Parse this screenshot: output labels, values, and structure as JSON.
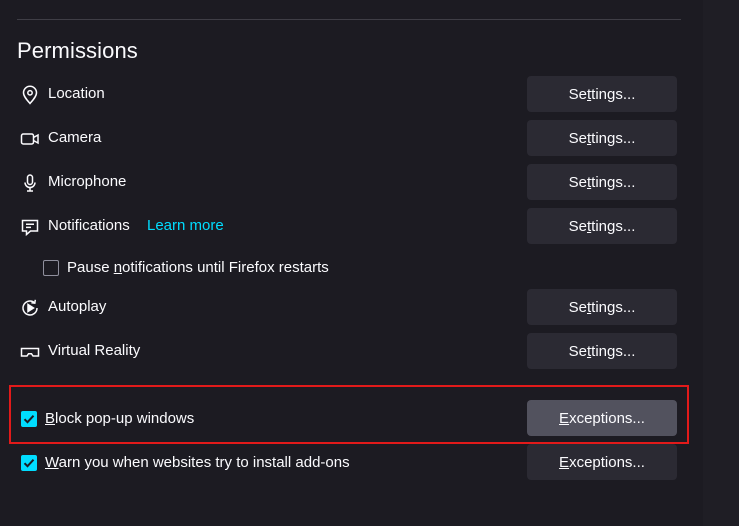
{
  "section": {
    "title": "Permissions"
  },
  "permissions": [
    {
      "label": "Location",
      "icon": "location-pin-icon",
      "button": "Settings..."
    },
    {
      "label": "Camera",
      "icon": "camera-icon",
      "button": "Settings..."
    },
    {
      "label": "Microphone",
      "icon": "microphone-icon",
      "button": "Settings..."
    },
    {
      "label": "Notifications",
      "icon": "notifications-icon",
      "button": "Settings...",
      "learn_more": "Learn more"
    },
    {
      "label": "Autoplay",
      "icon": "autoplay-icon",
      "button": "Settings..."
    },
    {
      "label": "Virtual Reality",
      "icon": "vr-headset-icon",
      "button": "Settings..."
    }
  ],
  "pause_notifications": {
    "label_pre": "Pause ",
    "label_key": "n",
    "label_post": "otifications until Firefox restarts",
    "checked": false
  },
  "block_popups": {
    "label_key": "B",
    "label_post": "lock pop-up windows",
    "checked": true,
    "button_key": "E",
    "button_post": "xceptions...",
    "highlighted": true
  },
  "warn_addons": {
    "label_key": "W",
    "label_post": "arn you when websites try to install add-ons",
    "checked": true,
    "button_key": "E",
    "button_post": "xceptions..."
  },
  "settings_button": {
    "pre": "Se",
    "key": "t",
    "post": "tings..."
  },
  "colors": {
    "background": "#1c1b22",
    "button": "#2b2a33",
    "button_active": "#52525e",
    "accent": "#00ddff",
    "highlight_border": "#e21a1a"
  }
}
